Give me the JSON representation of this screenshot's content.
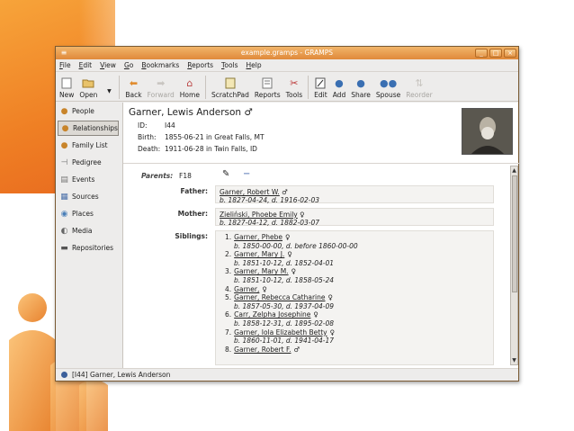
{
  "window": {
    "title": "example.gramps - GRAMPS"
  },
  "menu": [
    "File",
    "Edit",
    "View",
    "Go",
    "Bookmarks",
    "Reports",
    "Tools",
    "Help"
  ],
  "toolbar": [
    {
      "label": "New",
      "icon": "new-icon",
      "enabled": true
    },
    {
      "label": "Open",
      "icon": "open-icon",
      "enabled": true
    },
    {
      "label": "Back",
      "icon": "back-arrow-icon",
      "enabled": true
    },
    {
      "label": "Forward",
      "icon": "forward-arrow-icon",
      "enabled": false
    },
    {
      "label": "Home",
      "icon": "home-icon",
      "enabled": true
    },
    {
      "label": "ScratchPad",
      "icon": "scratchpad-icon",
      "enabled": true
    },
    {
      "label": "Reports",
      "icon": "reports-icon",
      "enabled": true
    },
    {
      "label": "Tools",
      "icon": "tools-icon",
      "enabled": true
    },
    {
      "label": "Edit",
      "icon": "edit-icon",
      "enabled": true
    },
    {
      "label": "Add",
      "icon": "add-person-icon",
      "enabled": true
    },
    {
      "label": "Share",
      "icon": "share-icon",
      "enabled": true
    },
    {
      "label": "Spouse",
      "icon": "spouse-icon",
      "enabled": true
    },
    {
      "label": "Reorder",
      "icon": "reorder-icon",
      "enabled": false
    }
  ],
  "sidebar": [
    {
      "label": "People",
      "icon": "people-icon",
      "active": false
    },
    {
      "label": "Relationships",
      "icon": "relationships-icon",
      "active": true
    },
    {
      "label": "Family List",
      "icon": "family-list-icon",
      "active": false
    },
    {
      "label": "Pedigree",
      "icon": "pedigree-icon",
      "active": false
    },
    {
      "label": "Events",
      "icon": "events-icon",
      "active": false
    },
    {
      "label": "Sources",
      "icon": "sources-icon",
      "active": false
    },
    {
      "label": "Places",
      "icon": "places-icon",
      "active": false
    },
    {
      "label": "Media",
      "icon": "media-icon",
      "active": false
    },
    {
      "label": "Repositories",
      "icon": "repositories-icon",
      "active": false
    }
  ],
  "person": {
    "name": "Garner, Lewis Anderson ♂",
    "id_label": "ID:",
    "id": "I44",
    "birth_label": "Birth:",
    "birth": "1855-06-21 in Great Falls, MT",
    "death_label": "Death:",
    "death": "1911-06-28 in Twin Falls, ID"
  },
  "family": {
    "parents_label": "Parents:",
    "parents_id": "F18",
    "father_label": "Father:",
    "father_name": "Garner, Robert W.",
    "father_sex": "♂",
    "father_dates": "b. 1827-04-24, d. 1916-02-03",
    "mother_label": "Mother:",
    "mother_name": "Zieliński, Phoebe Emily",
    "mother_sex": "♀",
    "mother_dates": "b. 1827-04-12, d. 1882-03-07",
    "siblings_label": "Siblings:",
    "siblings": [
      {
        "num": "1.",
        "name": "Garner, Phebe",
        "sex": "♀",
        "dates": "b. 1850-00-00, d. before 1860-00-00"
      },
      {
        "num": "2.",
        "name": "Garner, Mary J.",
        "sex": "♀",
        "dates": "b. 1851-10-12, d. 1852-04-01"
      },
      {
        "num": "3.",
        "name": "Garner, Mary M.",
        "sex": "♀",
        "dates": "b. 1851-10-12, d. 1858-05-24"
      },
      {
        "num": "4.",
        "name": "Garner,",
        "sex": "♀",
        "dates": ""
      },
      {
        "num": "5.",
        "name": "Garner, Rebecca Catharine",
        "sex": "♀",
        "dates": "b. 1857-05-30, d. 1937-04-09"
      },
      {
        "num": "6.",
        "name": "Carr, Zelpha Josephine",
        "sex": "♀",
        "dates": "b. 1858-12-31, d. 1895-02-08"
      },
      {
        "num": "7.",
        "name": "Garner, Iola Elizabeth Betty",
        "sex": "♀",
        "dates": "b. 1860-11-01, d. 1941-04-17"
      },
      {
        "num": "8.",
        "name": "Garner, Robert F.",
        "sex": "♂",
        "dates": ""
      }
    ]
  },
  "status": {
    "text": "[I44] Garner, Lewis Anderson"
  }
}
